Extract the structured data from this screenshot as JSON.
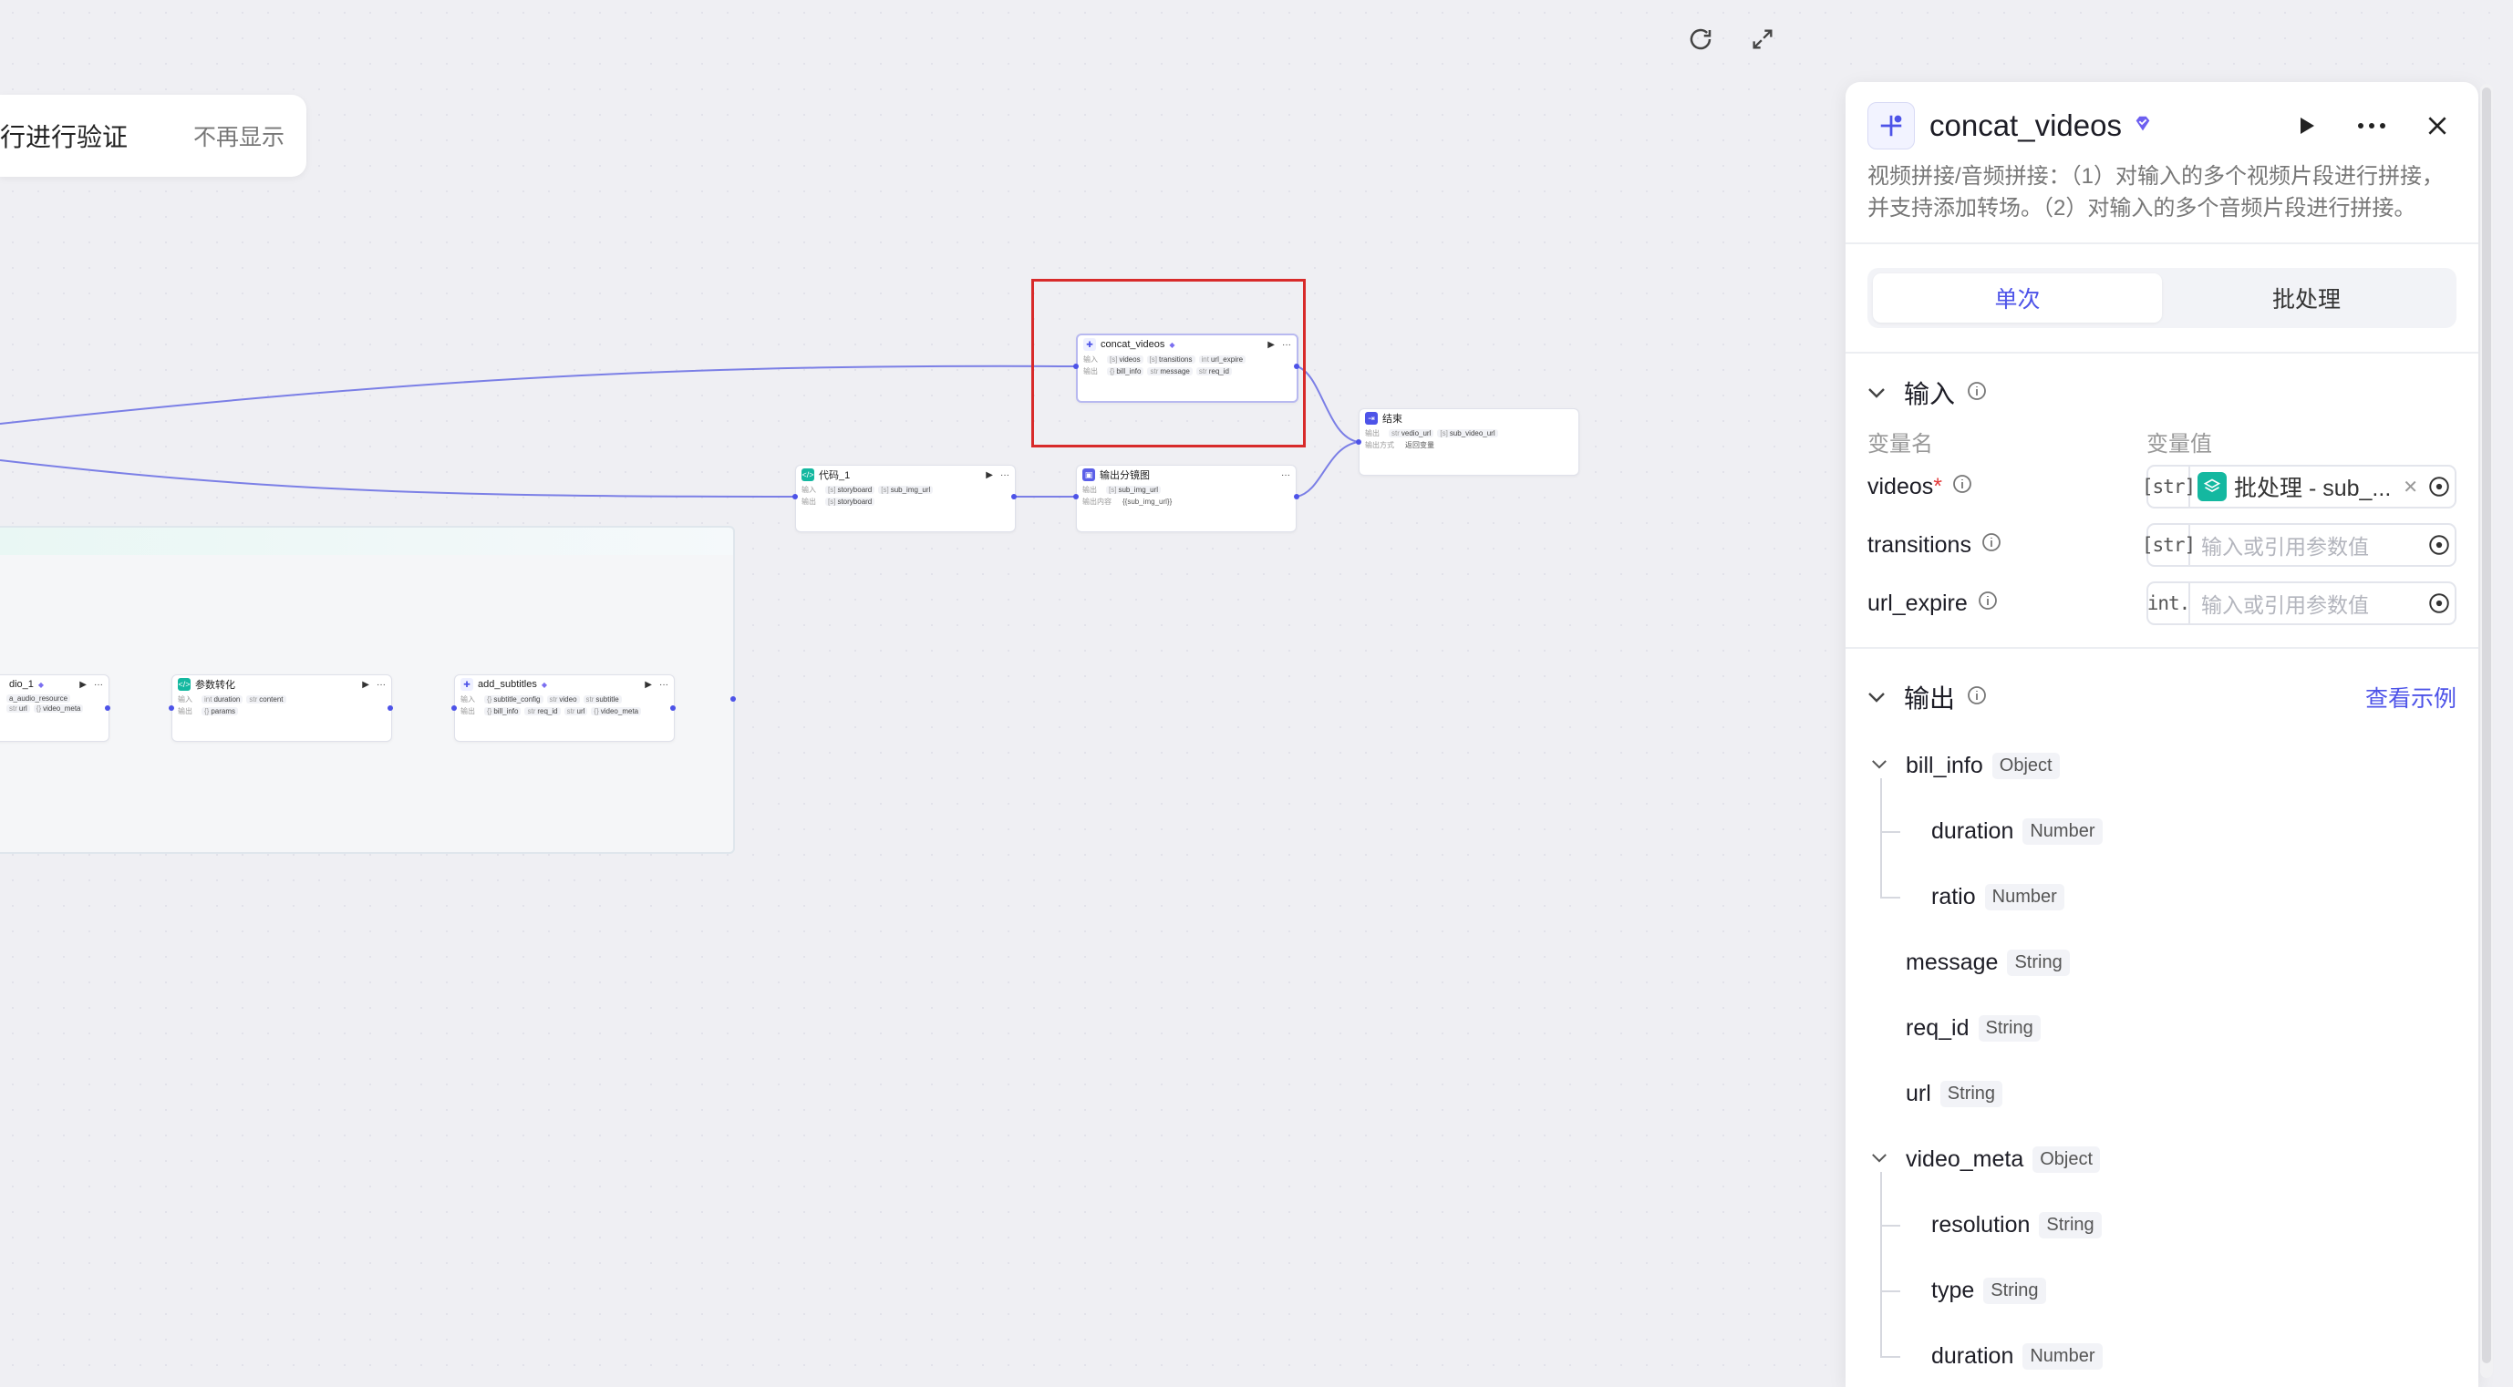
{
  "toast": {
    "message": "行进行验证",
    "dismiss": "不再显示"
  },
  "nodes": {
    "concat": {
      "title": "concat_videos",
      "in_label": "输入",
      "out_label": "输出",
      "inputs": [
        "videos",
        "transitions",
        "url_expire"
      ],
      "outputs": [
        "bill_info",
        "message",
        "req_id"
      ]
    },
    "end": {
      "title": "结束",
      "row1_label": "输出",
      "row1": [
        "vedio_url",
        "sub_video_url"
      ],
      "row2_label": "输出方式",
      "row2": "返回变量"
    },
    "code1": {
      "title": "代码_1",
      "in_label": "输入",
      "out_label": "输出",
      "inputs": [
        "storyboard",
        "sub_img_url"
      ],
      "outputs": [
        "storyboard"
      ]
    },
    "output_sb": {
      "title": "输出分镜图",
      "in_label": "输出",
      "inputs": [
        "sub_img_url"
      ],
      "row2_label": "输出内容",
      "row2": "{{sub_img_url}}"
    },
    "audio1": {
      "title": "dio_1",
      "row1": [
        "a_audio_resource"
      ],
      "row2": [
        "url",
        "video_meta"
      ]
    },
    "param": {
      "title": "参数转化",
      "in_label": "输入",
      "out_label": "输出",
      "inputs": [
        "duration",
        "content"
      ],
      "outputs": [
        "params"
      ]
    },
    "subs": {
      "title": "add_subtitles",
      "in_label": "输入",
      "out_label": "输出",
      "inputs": [
        "subtitle_config",
        "video",
        "subtitle"
      ],
      "outputs": [
        "bill_info",
        "req_id",
        "url",
        "video_meta"
      ]
    }
  },
  "panel": {
    "title": "concat_videos",
    "description": "视频拼接/音频拼接：（1）对输入的多个视频片段进行拼接，并支持添加转场。（2）对输入的多个音频片段进行拼接。",
    "tabs": [
      "单次",
      "批处理"
    ],
    "active_tab": "单次",
    "input_section": "输入",
    "col_name": "变量名",
    "col_value": "变量值",
    "inputs": [
      {
        "name": "videos",
        "required": "*",
        "type": "[str]",
        "value": "批处理 - sub_...",
        "placeholder": ""
      },
      {
        "name": "transitions",
        "required": "",
        "type": "[str]",
        "value": "",
        "placeholder": "输入或引用参数值"
      },
      {
        "name": "url_expire",
        "required": "",
        "type": "int.",
        "value": "",
        "placeholder": "输入或引用参数值"
      }
    ],
    "output_section": "输出",
    "view_example": "查看示例",
    "outputs": [
      {
        "name": "bill_info",
        "type": "Object",
        "level": 0,
        "expandable": true
      },
      {
        "name": "duration",
        "type": "Number",
        "level": 1,
        "expandable": false
      },
      {
        "name": "ratio",
        "type": "Number",
        "level": 1,
        "expandable": false
      },
      {
        "name": "message",
        "type": "String",
        "level": 0,
        "expandable": false
      },
      {
        "name": "req_id",
        "type": "String",
        "level": 0,
        "expandable": false
      },
      {
        "name": "url",
        "type": "String",
        "level": 0,
        "expandable": false
      },
      {
        "name": "video_meta",
        "type": "Object",
        "level": 0,
        "expandable": true
      },
      {
        "name": "resolution",
        "type": "String",
        "level": 1,
        "expandable": false
      },
      {
        "name": "type",
        "type": "String",
        "level": 1,
        "expandable": false
      },
      {
        "name": "duration",
        "type": "Number",
        "level": 1,
        "expandable": false
      }
    ]
  },
  "colors": {
    "accent": "#4d53e8",
    "highlight_box": "#d82a2a",
    "batch_badge": "#14b8a0"
  },
  "icons": [
    "refresh-icon",
    "fullscreen-icon",
    "play-icon",
    "more-icon",
    "close-icon",
    "info-icon",
    "chevron-down-icon",
    "reference-icon",
    "plugin-icon",
    "verified-icon"
  ]
}
